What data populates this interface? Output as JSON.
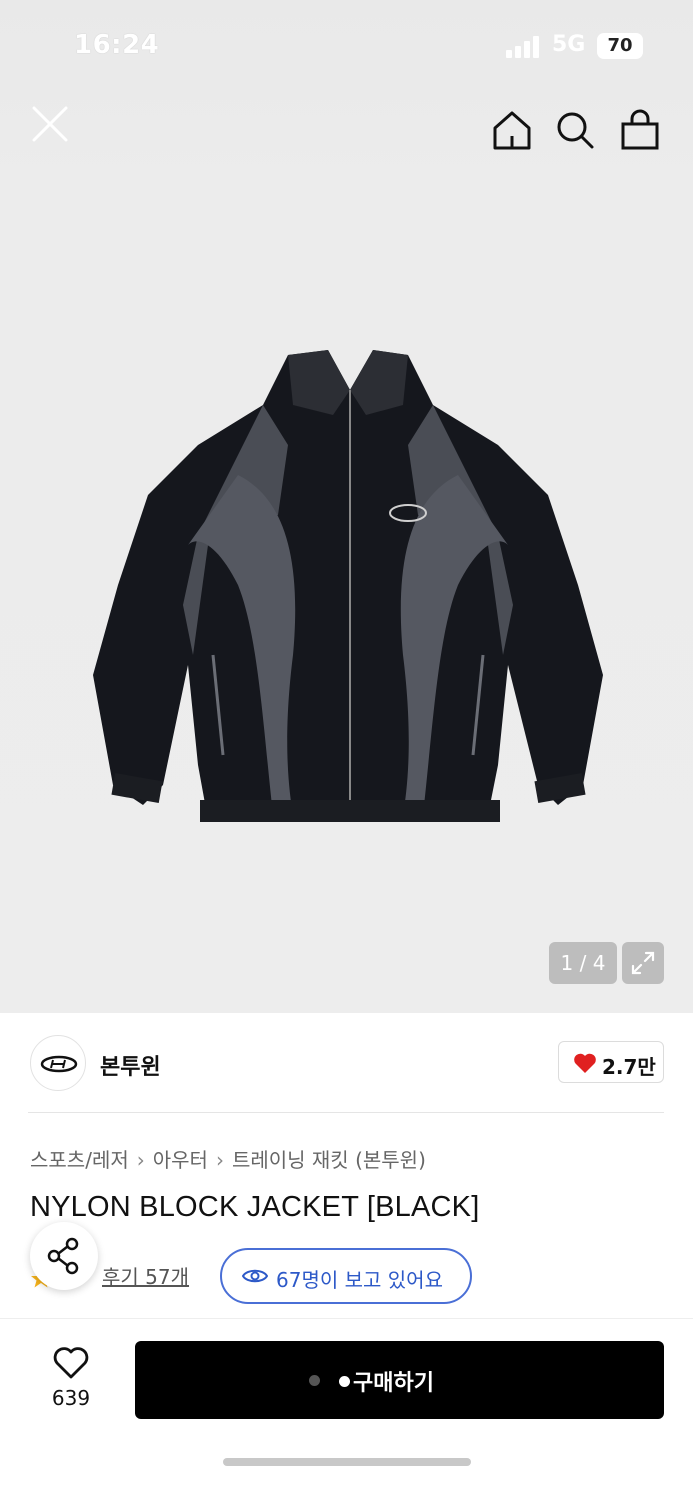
{
  "status_bar": {
    "time": "16:24",
    "network": "5G",
    "battery": "70"
  },
  "nav": {
    "close_icon": "close-icon",
    "icons": [
      "home-icon",
      "search-icon",
      "bag-icon"
    ]
  },
  "gallery": {
    "counter": "1 / 4",
    "expand_icon": "expand-icon"
  },
  "brand": {
    "name": "본투윈",
    "likes": "2.7만"
  },
  "breadcrumb": {
    "items": [
      "스포츠/레저",
      "아우터",
      "트레이닝 재킷 (본투윈)"
    ]
  },
  "product": {
    "title": "NYLON BLOCK JACKET [BLACK]",
    "review_link": "후기 57개",
    "viewers_text": "67명이 보고 있어요"
  },
  "bottom_bar": {
    "wish_count": "639",
    "buy_label": "구매하기"
  },
  "colors": {
    "accent_blue": "#2d59c8",
    "heart_red": "#e02020",
    "buy_button": "#000000"
  }
}
